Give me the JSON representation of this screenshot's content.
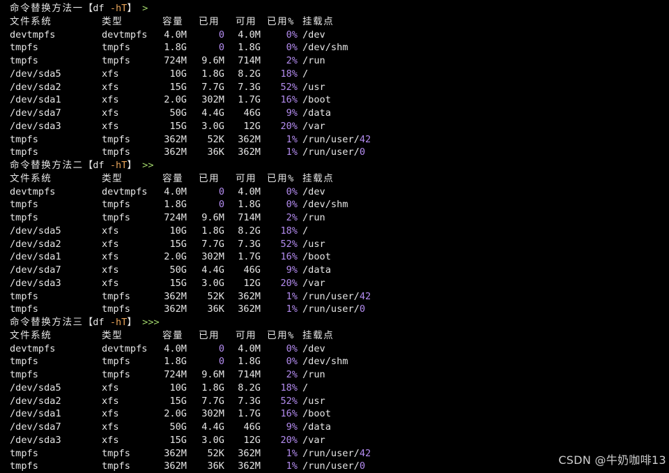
{
  "colors": {
    "background": "#000000",
    "text": "#e6e6e6",
    "zero": "#b48cf0",
    "option": "#e8a45a",
    "prompt": "#9fd36a"
  },
  "blocks": [
    {
      "title": "命令替换方法一",
      "cmd_open": "【",
      "cmd": "df",
      "opt": "-hT",
      "cmd_close": "】",
      "prompt": ">",
      "header": [
        "文件系统",
        "类型",
        "容量",
        "已用",
        "可用",
        "已用%",
        "挂载点"
      ],
      "rows": [
        [
          "devtmpfs",
          "devtmpfs",
          "4.0M",
          "0",
          "4.0M",
          "0%",
          "/dev"
        ],
        [
          "tmpfs",
          "tmpfs",
          "1.8G",
          "0",
          "1.8G",
          "0%",
          "/dev/shm"
        ],
        [
          "tmpfs",
          "tmpfs",
          "724M",
          "9.6M",
          "714M",
          "2%",
          "/run"
        ],
        [
          "/dev/sda5",
          "xfs",
          "10G",
          "1.8G",
          "8.2G",
          "18%",
          "/"
        ],
        [
          "/dev/sda2",
          "xfs",
          "15G",
          "7.7G",
          "7.3G",
          "52%",
          "/usr"
        ],
        [
          "/dev/sda1",
          "xfs",
          "2.0G",
          "302M",
          "1.7G",
          "16%",
          "/boot"
        ],
        [
          "/dev/sda7",
          "xfs",
          "50G",
          "4.4G",
          "46G",
          "9%",
          "/data"
        ],
        [
          "/dev/sda3",
          "xfs",
          "15G",
          "3.0G",
          "12G",
          "20%",
          "/var"
        ],
        [
          "tmpfs",
          "tmpfs",
          "362M",
          "52K",
          "362M",
          "1%",
          "/run/user/42"
        ],
        [
          "tmpfs",
          "tmpfs",
          "362M",
          "36K",
          "362M",
          "1%",
          "/run/user/0"
        ]
      ]
    },
    {
      "title": "命令替换方法二",
      "cmd_open": "【",
      "cmd": "df",
      "opt": "-hT",
      "cmd_close": "】",
      "prompt": ">>",
      "header": [
        "文件系统",
        "类型",
        "容量",
        "已用",
        "可用",
        "已用%",
        "挂载点"
      ],
      "rows": [
        [
          "devtmpfs",
          "devtmpfs",
          "4.0M",
          "0",
          "4.0M",
          "0%",
          "/dev"
        ],
        [
          "tmpfs",
          "tmpfs",
          "1.8G",
          "0",
          "1.8G",
          "0%",
          "/dev/shm"
        ],
        [
          "tmpfs",
          "tmpfs",
          "724M",
          "9.6M",
          "714M",
          "2%",
          "/run"
        ],
        [
          "/dev/sda5",
          "xfs",
          "10G",
          "1.8G",
          "8.2G",
          "18%",
          "/"
        ],
        [
          "/dev/sda2",
          "xfs",
          "15G",
          "7.7G",
          "7.3G",
          "52%",
          "/usr"
        ],
        [
          "/dev/sda1",
          "xfs",
          "2.0G",
          "302M",
          "1.7G",
          "16%",
          "/boot"
        ],
        [
          "/dev/sda7",
          "xfs",
          "50G",
          "4.4G",
          "46G",
          "9%",
          "/data"
        ],
        [
          "/dev/sda3",
          "xfs",
          "15G",
          "3.0G",
          "12G",
          "20%",
          "/var"
        ],
        [
          "tmpfs",
          "tmpfs",
          "362M",
          "52K",
          "362M",
          "1%",
          "/run/user/42"
        ],
        [
          "tmpfs",
          "tmpfs",
          "362M",
          "36K",
          "362M",
          "1%",
          "/run/user/0"
        ]
      ]
    },
    {
      "title": "命令替换方法三",
      "cmd_open": "【",
      "cmd": "df",
      "opt": "-hT",
      "cmd_close": "】",
      "prompt": ">>>",
      "header": [
        "文件系统",
        "类型",
        "容量",
        "已用",
        "可用",
        "已用%",
        "挂载点"
      ],
      "rows": [
        [
          "devtmpfs",
          "devtmpfs",
          "4.0M",
          "0",
          "4.0M",
          "0%",
          "/dev"
        ],
        [
          "tmpfs",
          "tmpfs",
          "1.8G",
          "0",
          "1.8G",
          "0%",
          "/dev/shm"
        ],
        [
          "tmpfs",
          "tmpfs",
          "724M",
          "9.6M",
          "714M",
          "2%",
          "/run"
        ],
        [
          "/dev/sda5",
          "xfs",
          "10G",
          "1.8G",
          "8.2G",
          "18%",
          "/"
        ],
        [
          "/dev/sda2",
          "xfs",
          "15G",
          "7.7G",
          "7.3G",
          "52%",
          "/usr"
        ],
        [
          "/dev/sda1",
          "xfs",
          "2.0G",
          "302M",
          "1.7G",
          "16%",
          "/boot"
        ],
        [
          "/dev/sda7",
          "xfs",
          "50G",
          "4.4G",
          "46G",
          "9%",
          "/data"
        ],
        [
          "/dev/sda3",
          "xfs",
          "15G",
          "3.0G",
          "12G",
          "20%",
          "/var"
        ],
        [
          "tmpfs",
          "tmpfs",
          "362M",
          "52K",
          "362M",
          "1%",
          "/run/user/42"
        ],
        [
          "tmpfs",
          "tmpfs",
          "362M",
          "36K",
          "362M",
          "1%",
          "/run/user/0"
        ]
      ]
    }
  ],
  "watermark": "CSDN @牛奶咖啡13"
}
